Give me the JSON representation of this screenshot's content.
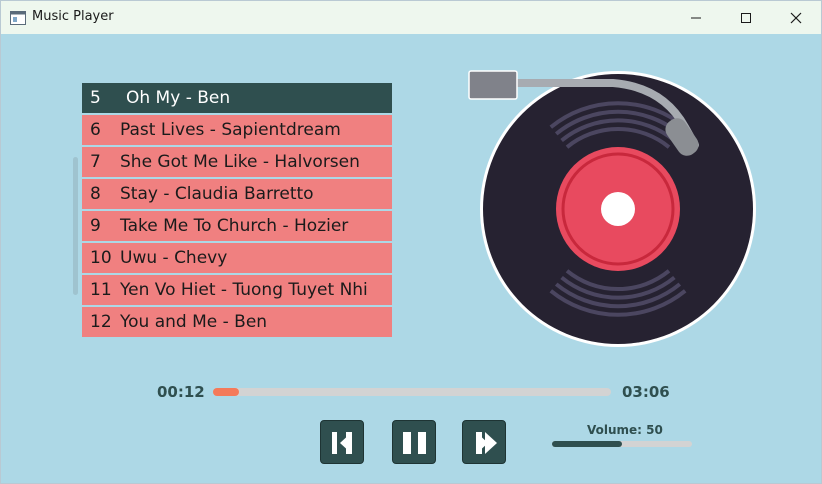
{
  "window": {
    "title": "Music Player",
    "controls": {
      "minimize": "minimize-icon",
      "maximize": "maximize-icon",
      "close": "close-icon"
    }
  },
  "playlist": {
    "selected_index": 0,
    "items": [
      {
        "num": "5",
        "name": "Oh My - Ben"
      },
      {
        "num": "6",
        "name": "Past Lives - Sapientdream"
      },
      {
        "num": "7",
        "name": "She Got Me Like - Halvorsen"
      },
      {
        "num": "8",
        "name": "Stay - Claudia Barretto"
      },
      {
        "num": "9",
        "name": "Take Me To Church - Hozier"
      },
      {
        "num": "10",
        "name": "Uwu - Chevy"
      },
      {
        "num": "11",
        "name": "Yen Vo Hiet - Tuong Tuyet Nhi"
      },
      {
        "num": "12",
        "name": "You and Me - Ben"
      }
    ]
  },
  "player": {
    "current_time": "00:12",
    "total_time": "03:06",
    "progress": 0.065,
    "volume_label": "Volume: 50",
    "volume": 0.5,
    "buttons": {
      "prev": "previous-icon",
      "pause": "pause-icon",
      "next": "next-icon"
    }
  },
  "colors": {
    "background": "#add8e6",
    "selected_row": "#2f4f4f",
    "row": "#f08080",
    "progress_fill": "#f47a5a",
    "button": "#2f4f4f",
    "record_label": "#e84a5f"
  }
}
